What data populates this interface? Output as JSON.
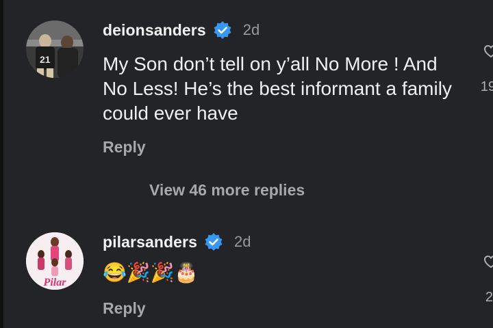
{
  "comments": [
    {
      "username": "deionsanders",
      "time": "2d",
      "text": "My Son don’t tell on y’all No More ! And No Less! He’s the best informant a family could ever have",
      "reply_label": "Reply",
      "like_count": "19",
      "view_replies_label": "View 46 more replies"
    },
    {
      "username": "pilarsanders",
      "time": "2d",
      "emojis": "😂🎉🎉🎂",
      "reply_label": "Reply",
      "like_count": "2"
    }
  ],
  "avatar2_text": "Pilar",
  "avatar1_jersey": "21",
  "colors": {
    "background": "#232427",
    "verified": "#3897f0",
    "muted_text": "#a8a8a8"
  }
}
